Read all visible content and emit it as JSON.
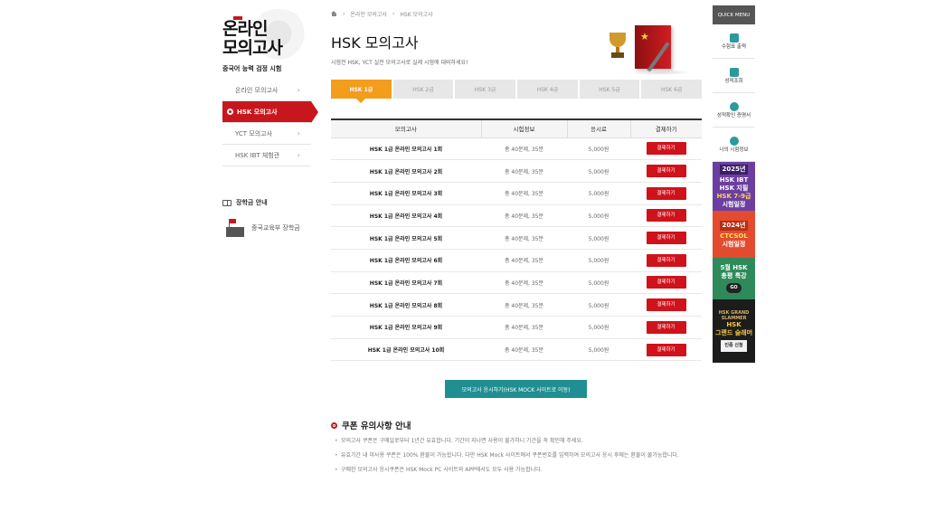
{
  "brand": {
    "title_line1": "온라인",
    "title_line2": "모의고사",
    "subtitle": "중국어 능력 검정 시험"
  },
  "sidebar": {
    "items": [
      {
        "label": "온라인 모의고사",
        "active": false
      },
      {
        "label": "HSK 모의고사",
        "active": true
      },
      {
        "label": "YCT 모의고사",
        "active": false
      },
      {
        "label": "HSK IBT 체험관",
        "active": false
      }
    ],
    "scholarship_title": "장학금 안내",
    "scholarship_item": "중국교육부 장학금"
  },
  "breadcrumb": [
    "온라인 모의고사",
    "HSK 모의고사"
  ],
  "page": {
    "title": "HSK 모의고사",
    "subtitle": "시험전 HSK, YCT 실전 모의고사로 실제 시험에 대비하세요!"
  },
  "tabs": [
    "HSK 1급",
    "HSK 2급",
    "HSK 3급",
    "HSK 4급",
    "HSK 5급",
    "HSK 6급"
  ],
  "active_tab_index": 0,
  "table": {
    "headers": [
      "모의고사",
      "시험정보",
      "응시료",
      "결제하기"
    ],
    "rows": [
      {
        "name": "HSK 1급 온라인 모의고사 1회",
        "info": "총 40문제, 35분",
        "fee": "5,000원",
        "button": "결제하기"
      },
      {
        "name": "HSK 1급 온라인 모의고사 2회",
        "info": "총 40문제, 35분",
        "fee": "5,000원",
        "button": "결제하기"
      },
      {
        "name": "HSK 1급 온라인 모의고사 3회",
        "info": "총 40문제, 35분",
        "fee": "5,000원",
        "button": "결제하기"
      },
      {
        "name": "HSK 1급 온라인 모의고사 4회",
        "info": "총 40문제, 35분",
        "fee": "5,000원",
        "button": "결제하기"
      },
      {
        "name": "HSK 1급 온라인 모의고사 5회",
        "info": "총 40문제, 35분",
        "fee": "5,000원",
        "button": "결제하기"
      },
      {
        "name": "HSK 1급 온라인 모의고사 6회",
        "info": "총 40문제, 35분",
        "fee": "5,000원",
        "button": "결제하기"
      },
      {
        "name": "HSK 1급 온라인 모의고사 7회",
        "info": "총 40문제, 35분",
        "fee": "5,000원",
        "button": "결제하기"
      },
      {
        "name": "HSK 1급 온라인 모의고사 8회",
        "info": "총 40문제, 35분",
        "fee": "5,000원",
        "button": "결제하기"
      },
      {
        "name": "HSK 1급 온라인 모의고사 9회",
        "info": "총 40문제, 35분",
        "fee": "5,000원",
        "button": "결제하기"
      },
      {
        "name": "HSK 1급 온라인 모의고사 10회",
        "info": "총 40문제, 35분",
        "fee": "5,000원",
        "button": "결제하기"
      }
    ]
  },
  "mock_button": "모의고사 응시하기(HSK MOCK 사이트로 이동)",
  "notice": {
    "title": "쿠폰 유의사항 안내",
    "items": [
      "모의고사 쿠폰은 구매일로부터 1년간 유효합니다. 기간이 지나면 사용이 불가하니 기간을 꼭 확인해 주세요.",
      "유효기간 내 미사용 쿠폰은 100% 환불이 가능합니다. 다만 HSK Mock 사이트에서 쿠폰번호를 입력하여 모의고사 응시 후에는 환불이 불가능합니다.",
      "구매한 모의고사 응시쿠폰은 HSK Mock PC 사이트와 APP에서도 모두 사용 가능합니다."
    ]
  },
  "quick_menu": {
    "title": "QUICK MENU",
    "items": [
      "수험표 출력",
      "성적조회",
      "성적확인 증명서",
      "나의 시험정보"
    ],
    "banners": {
      "b1_year": "2025년",
      "b1_lines": [
        "HSK IBT",
        "HSK 지필",
        "HSK 7-9급",
        "시험일정"
      ],
      "b2_year": "2024년",
      "b2_lines": [
        "CTCSOL",
        "시험일정"
      ],
      "b3_lines": [
        "5월 HSK",
        "총평 특강"
      ],
      "b3_go": "GO",
      "b4_crest": "HSK GRAND SLAMMER",
      "b4_lines": [
        "HSK",
        "그랜드 슬래머"
      ],
      "b4_button": "인증 신청"
    }
  },
  "colors": {
    "brand_red": "#c8161d",
    "tab_orange": "#f29d1c",
    "button_teal": "#1f8f91"
  }
}
